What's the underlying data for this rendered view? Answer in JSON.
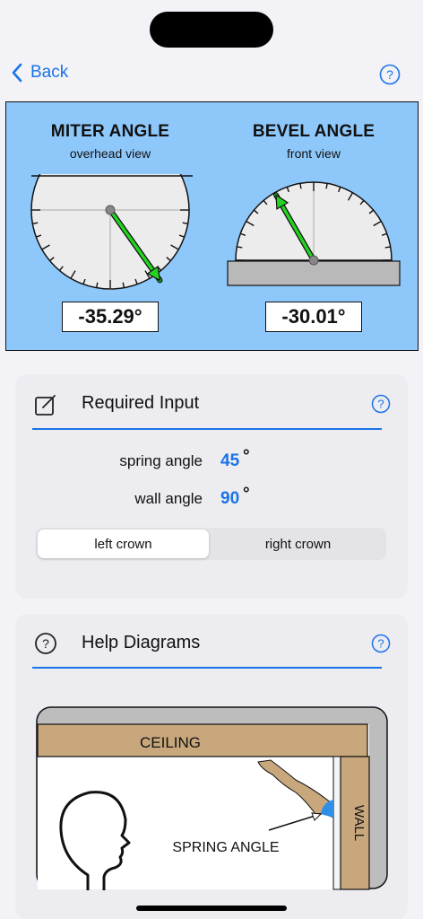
{
  "nav": {
    "back_label": "Back"
  },
  "miter": {
    "title": "MITER ANGLE",
    "subtitle": "overhead view",
    "value": "-35.29°",
    "angle_deg": -35.29
  },
  "bevel": {
    "title": "BEVEL ANGLE",
    "subtitle": "front view",
    "value": "-30.01°",
    "angle_deg": -30.01
  },
  "required_input": {
    "title": "Required Input",
    "spring_label": "spring angle",
    "spring_value": "45",
    "wall_label": "wall angle",
    "wall_value": "90",
    "degree_symbol": "°",
    "segments": [
      "left crown",
      "right crown"
    ],
    "selected_segment": "left crown"
  },
  "help_diagrams": {
    "title": "Help Diagrams",
    "ceiling_label": "CEILING",
    "wall_label": "WALL",
    "spring_angle_label": "SPRING ANGLE"
  },
  "colors": {
    "accent": "#1a73e8",
    "panel": "#8ec8fb",
    "needle": "#22d41f",
    "wood": "#c8a77c"
  }
}
